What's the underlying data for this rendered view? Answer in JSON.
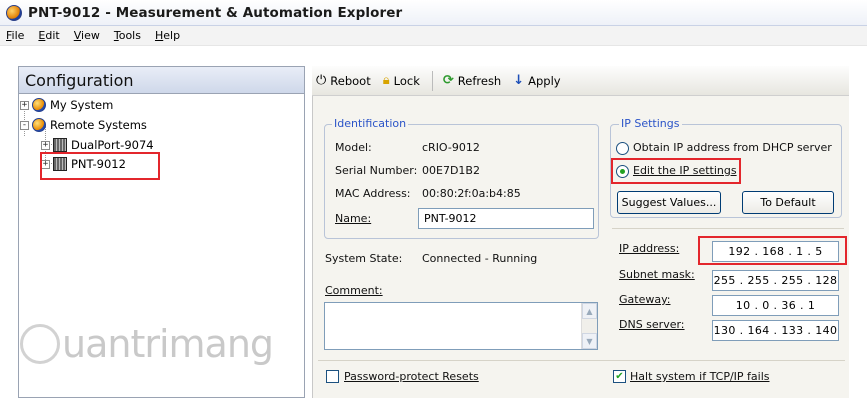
{
  "window": {
    "title": "PNT-9012 - Measurement & Automation Explorer"
  },
  "menu": [
    "File",
    "Edit",
    "View",
    "Tools",
    "Help"
  ],
  "left_panel": {
    "header": "Configuration",
    "tree": [
      {
        "label": "My System",
        "expander": "+"
      },
      {
        "label": "Remote Systems",
        "expander": "-"
      },
      {
        "label": "DualPort-9074",
        "expander": "+"
      },
      {
        "label": "PNT-9012",
        "expander": "+"
      }
    ]
  },
  "watermark": "uantrimang",
  "toolbar": {
    "reboot": "Reboot",
    "lock": "Lock",
    "refresh": "Refresh",
    "apply": "Apply"
  },
  "identification": {
    "group_label": "Identification",
    "model_label": "Model:",
    "model_value": "cRIO-9012",
    "serial_label": "Serial Number:",
    "serial_value": "00E7D1B2",
    "mac_label": "MAC Address:",
    "mac_value": "00:80:2f:0a:b4:85",
    "name_label": "Name:",
    "name_value": "PNT-9012"
  },
  "system_state": {
    "label": "System State:",
    "value": "Connected - Running"
  },
  "comment": {
    "label": "Comment:"
  },
  "password_protect": {
    "label": "Password-protect Resets",
    "checked": false
  },
  "ip_settings": {
    "group_label": "IP Settings",
    "dhcp_option": "Obtain IP address from DHCP server",
    "edit_option": "Edit the IP settings",
    "selected": "edit",
    "suggest_button": "Suggest Values...",
    "default_button": "To Default",
    "ip_label": "IP address:",
    "ip_value": "192 . 168 . 1 . 5",
    "subnet_label": "Subnet mask:",
    "subnet_value": "255 . 255 . 255 . 128",
    "gateway_label": "Gateway:",
    "gateway_value": "10 . 0 . 36 . 1",
    "dns_label": "DNS server:",
    "dns_value": "130 . 164 . 133 . 140"
  },
  "halt_system": {
    "label": "Halt system if TCP/IP fails",
    "checked": true
  },
  "colors": {
    "highlight": "#e3262c",
    "group_label": "#2b54c8"
  }
}
